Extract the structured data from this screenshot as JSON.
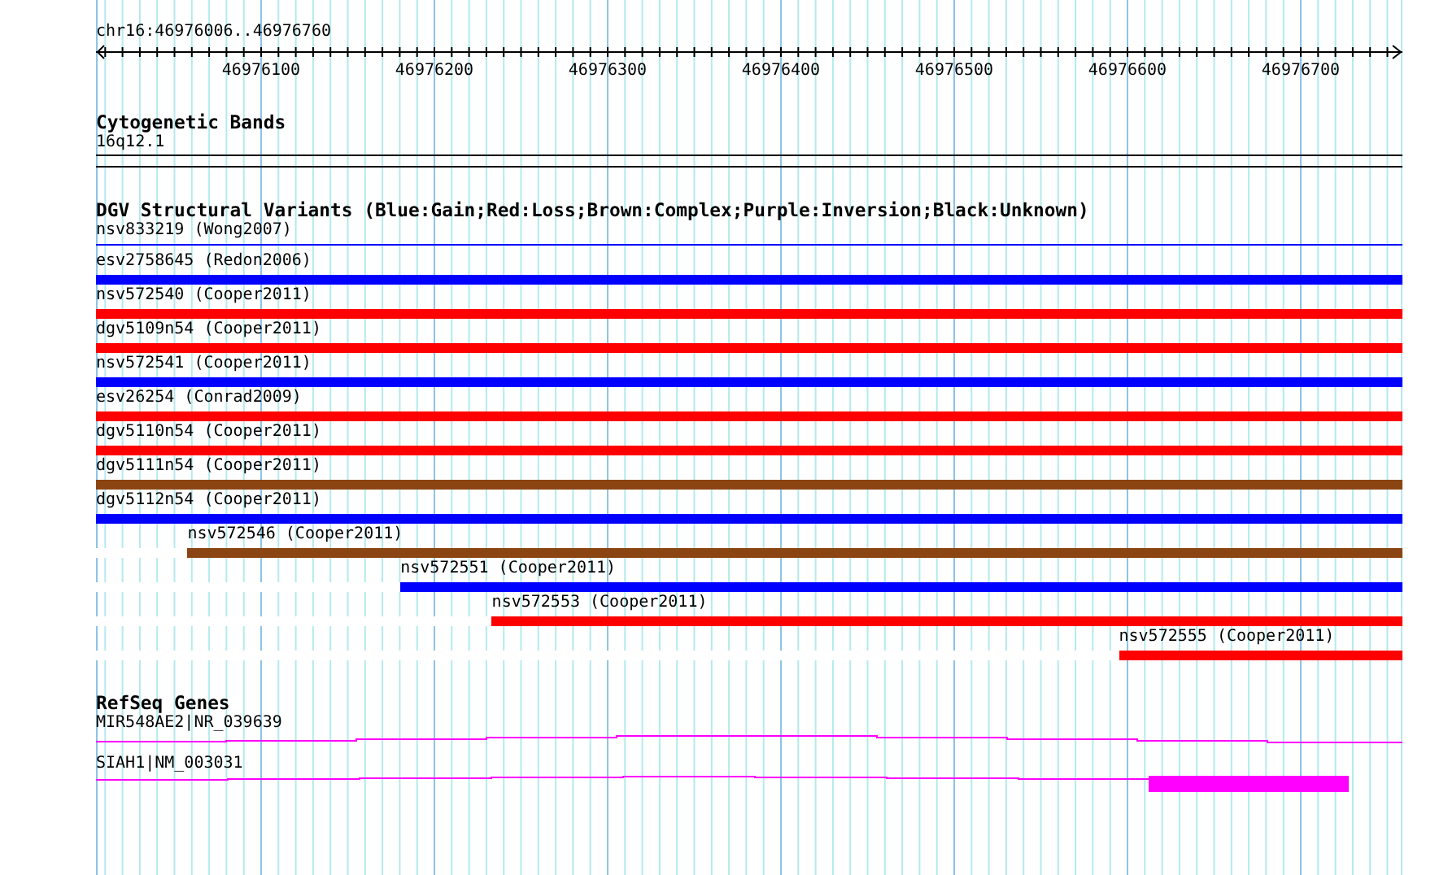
{
  "ruler": {
    "title": "chr16:46976006..46976760",
    "tick_labels": [
      "46976100",
      "46976200",
      "46976300",
      "46976400",
      "46976500",
      "46976600",
      "46976700"
    ]
  },
  "cytogenetic_bands": {
    "title": "Cytogenetic Bands",
    "band": "16q12.1"
  },
  "dgv_variants": {
    "title": "DGV Structural Variants (Blue:Gain;Red:Loss;Brown:Complex;Purple:Inversion;Black:Unknown)",
    "features": [
      {
        "label": "nsv833219 (Wong2007)",
        "kind": "line",
        "color": "#0000ff",
        "level": 1
      },
      {
        "label": "esv2758645 (Redon2006)",
        "kind": "bar",
        "color": "#0000ff",
        "level": 1
      },
      {
        "label": "nsv572540 (Cooper2011)",
        "kind": "bar",
        "color": "#ff0000",
        "level": 1
      },
      {
        "label": "dgv5109n54 (Cooper2011)",
        "kind": "bar",
        "color": "#ff0000",
        "level": 1
      },
      {
        "label": "nsv572541 (Cooper2011)",
        "kind": "bar",
        "color": "#0000ff",
        "level": 1
      },
      {
        "label": "esv26254 (Conrad2009)",
        "kind": "bar",
        "color": "#ff0000",
        "level": 1
      },
      {
        "label": "dgv5110n54 (Cooper2011)",
        "kind": "bar",
        "color": "#ff0000",
        "level": 1
      },
      {
        "label": "dgv5111n54 (Cooper2011)",
        "kind": "bar",
        "color": "#8b4513",
        "level": 1
      },
      {
        "label": "dgv5112n54 (Cooper2011)",
        "kind": "bar",
        "color": "#0000ff",
        "level": 1
      },
      {
        "label": "nsv572546 (Cooper2011)",
        "kind": "bar",
        "color": "#8b4513",
        "level": 0.93
      },
      {
        "label": "nsv572551 (Cooper2011)",
        "kind": "bar",
        "color": "#0000ff",
        "level": 0.767
      },
      {
        "label": "nsv572553 (Cooper2011)",
        "kind": "bar",
        "color": "#ff0000",
        "level": 0.697
      },
      {
        "label": "nsv572555 (Cooper2011)",
        "kind": "bar",
        "color": "#ff0000",
        "level": 0.217
      }
    ]
  },
  "refseq_genes": {
    "title": "RefSeq Genes",
    "genes": [
      {
        "label": "MIR548AE2|NR_039639",
        "kind": "noncoding"
      },
      {
        "label": "SIAH1|NM_003031",
        "kind": "coding"
      }
    ]
  }
}
